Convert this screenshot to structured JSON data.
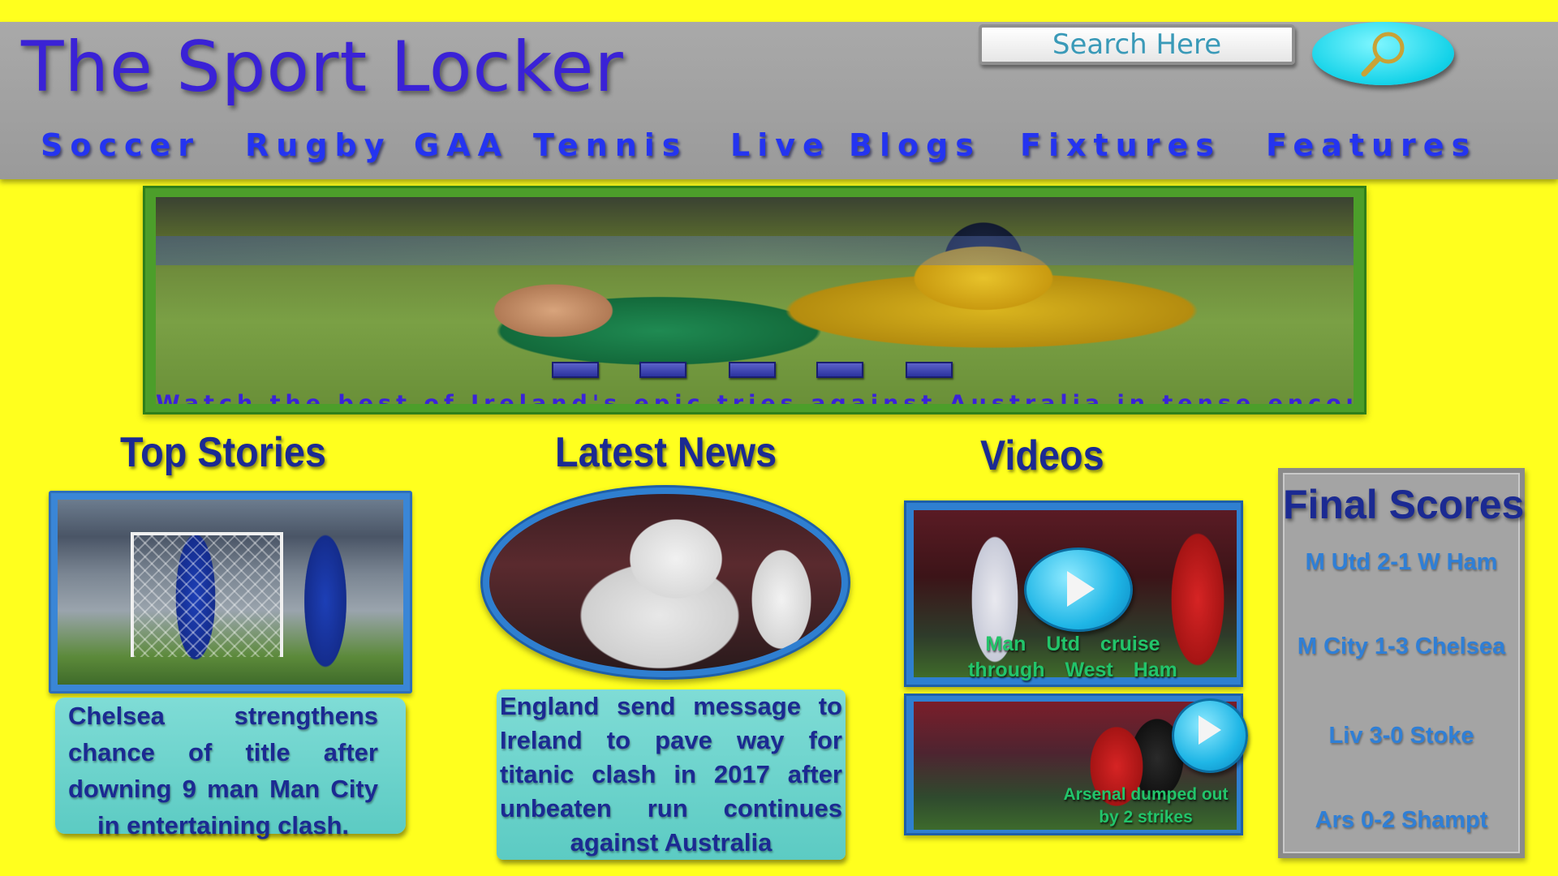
{
  "header": {
    "title": "The Sport Locker",
    "search_placeholder": "Search Here",
    "search_icon": "magnifier-icon"
  },
  "nav": [
    "Soccer",
    "Rugby",
    "GAA",
    "Tennis",
    "Live Blogs",
    "Fixtures",
    "Features"
  ],
  "banner": {
    "caption": "Watch the best of Ireland's epic tries against Australia in tense encounter",
    "slide_count": 5
  },
  "top_stories": {
    "heading": "Top Stories",
    "text": "Chelsea strengthens chance of title after downing 9 man Man City in entertaining clash."
  },
  "latest_news": {
    "heading": "Latest News",
    "text": "England send message to Ireland to pave way for titanic clash in 2017 after unbeaten run continues against Australia"
  },
  "videos": {
    "heading": "Videos",
    "items": [
      {
        "caption": "Man Utd cruise through West Ham",
        "icon": "play-icon"
      },
      {
        "caption": "Arsenal dumped out by 2 strikes",
        "icon": "play-icon"
      }
    ]
  },
  "final_scores": {
    "heading": "Final Scores",
    "results": [
      "M Utd 2-1 W Ham",
      "M City 1-3 Chelsea",
      "Liv 3-0 Stoke",
      "Ars 0-2 Shampt"
    ]
  },
  "colors": {
    "page_background": "#ffff1e",
    "header_background": "#a9a9a9",
    "title_color": "#3a22d6",
    "nav_color": "#2434f0",
    "heading_color": "#1b2a92",
    "text_panel": "#7fdcd6",
    "score_color": "#2f7fd6"
  }
}
